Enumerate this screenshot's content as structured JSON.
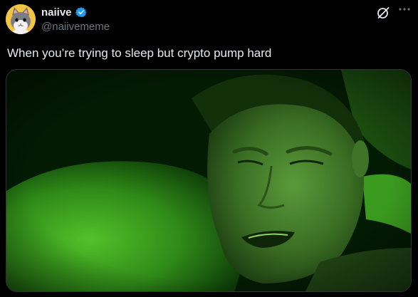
{
  "post": {
    "author": {
      "display_name": "naiive",
      "handle": "@naiivememe",
      "verified": true,
      "avatar_icon": "gray-cat-on-yellow-avatar"
    },
    "text": "When you’re trying to sleep but crypto pump hard",
    "media": {
      "description_icon": "night-vision-man-in-bed-photo"
    },
    "icons": {
      "grok": "grok-icon",
      "more": "more-options-icon"
    }
  },
  "colors": {
    "background": "#000000",
    "primary_text": "#e7e9ea",
    "secondary_text": "#71767b",
    "verified_blue": "#1d9bf0",
    "avatar_bg": "#f4c542",
    "night_vision_green": "#3f9b22"
  }
}
